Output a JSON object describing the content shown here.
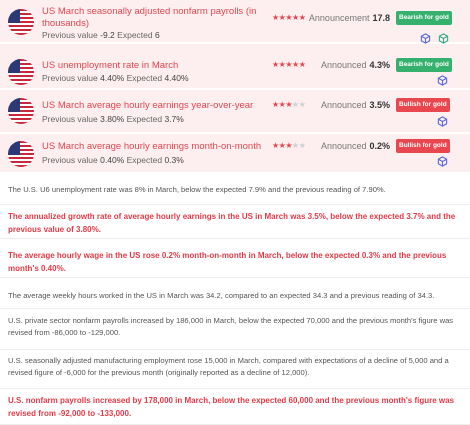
{
  "events": [
    {
      "title": "US March seasonally adjusted nonfarm payrolls (in thousands)",
      "previous_label": "Previous value",
      "previous_value": "-9.2",
      "expected_label": "Expected",
      "expected_value": "6",
      "stars": 5,
      "announcement_label": "Announcement",
      "announcement_value": "17.8",
      "badge": "Bearish for gold",
      "badge_color": "#35b06d",
      "icon": "us-flag-icon"
    },
    {
      "title": "US unemployment rate in March",
      "previous_label": "Previous value",
      "previous_value": "4.40%",
      "expected_label": "Expected",
      "expected_value": "4.40%",
      "stars": 5,
      "announcement_label": "Announced",
      "announcement_value": "4.3%",
      "badge": "Bearish for gold",
      "badge_color": "#35b06d",
      "icon": "us-flag-icon"
    },
    {
      "title": "US March average hourly earnings year-over-year",
      "previous_label": "Previous value",
      "previous_value": "3.80%",
      "expected_label": "Expected",
      "expected_value": "3.7%",
      "stars": 3,
      "announcement_label": "Announced",
      "announcement_value": "3.5%",
      "badge": "Bullish for gold",
      "badge_color": "#e84750",
      "icon": "us-flag-icon"
    },
    {
      "title": "US March average hourly earnings month-on-month",
      "previous_label": "Previous value",
      "previous_value": "0.40%",
      "expected_label": "Expected",
      "expected_value": "0.3%",
      "stars": 3,
      "announcement_label": "Announced",
      "announcement_value": "0.2%",
      "badge": "Bullish for gold",
      "badge_color": "#e84750",
      "icon": "us-flag-icon"
    }
  ],
  "news": [
    {
      "text": "The U.S. U6 unemployment rate was 8% in March, below the expected 7.9% and the previous reading of 7.90%.",
      "highlight": false
    },
    {
      "text": "The annualized growth rate of average hourly earnings in the US in March was 3.5%, below the expected 3.7% and the previous value of 3.80%.",
      "highlight": true
    },
    {
      "text": "The average hourly wage in the US rose 0.2% month-on-month in March, below the expected 0.3% and the previous month's 0.40%.",
      "highlight": true
    },
    {
      "text": "The average weekly hours worked in the US in March was 34.2, compared to an expected 34.3 and a previous reading of 34.3.",
      "highlight": false
    },
    {
      "text": "U.S. private sector nonfarm payrolls increased by 186,000 in March, below the expected 70,000 and the previous month's figure was revised from -86,000 to -129,000.",
      "highlight": false
    },
    {
      "text": "U.S. seasonally adjusted manufacturing employment rose 15,000 in March, compared with expectations of a decline of 5,000 and a revised figure of -6,000 for the previous month (originally reported as a decline of 12,000).",
      "highlight": false
    },
    {
      "text": "U.S. nonfarm payrolls increased by 178,000 in March, below the expected 60,000 and the previous month's figure was revised from -92,000 to -133,000.",
      "highlight": true
    }
  ],
  "colors": {
    "event_bg": "#fdeef0",
    "title_red": "#e0484f",
    "highlight_red": "#e23a47",
    "bearish_green": "#35b06d",
    "bullish_red": "#e84750"
  }
}
